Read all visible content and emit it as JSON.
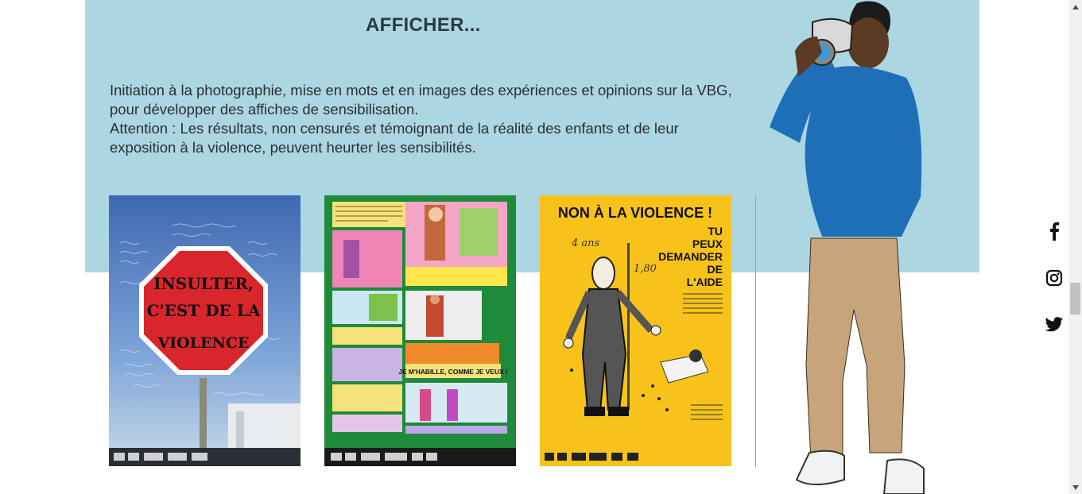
{
  "section": {
    "title": "AFFICHER...",
    "intro": [
      "Initiation à la photographie, mise en mots et en images des expériences et opinions sur la VBG, pour développer des affiches de sensibilisation.",
      "Attention : Les résultats, non censurés et témoignant de la réalité des enfants et de leur exposition à la violence, peuvent heurter les sensibilités."
    ]
  },
  "posters": {
    "p1": {
      "line1": "INSULTER,",
      "line2": "C'EST DE LA",
      "line3": "VIOLENCE"
    },
    "p2": {
      "banner": "JE M'HABILLE, COMME JE VEUX !"
    },
    "p3": {
      "title": "NON À LA VIOLENCE !",
      "sub1": "TU",
      "sub2": "PEUX",
      "sub3": "DEMANDER",
      "sub4": "DE",
      "sub5": "L'AIDE",
      "age": "4 ans",
      "height": "1,80"
    }
  },
  "social": {
    "icons": [
      "facebook-icon",
      "instagram-icon",
      "twitter-icon"
    ]
  },
  "colors": {
    "band": "#acd6e2",
    "title": "#2b3a45",
    "poster2_bg": "#1f8a3a",
    "poster3_bg": "#f7c31a",
    "stop_red": "#d9262c"
  }
}
